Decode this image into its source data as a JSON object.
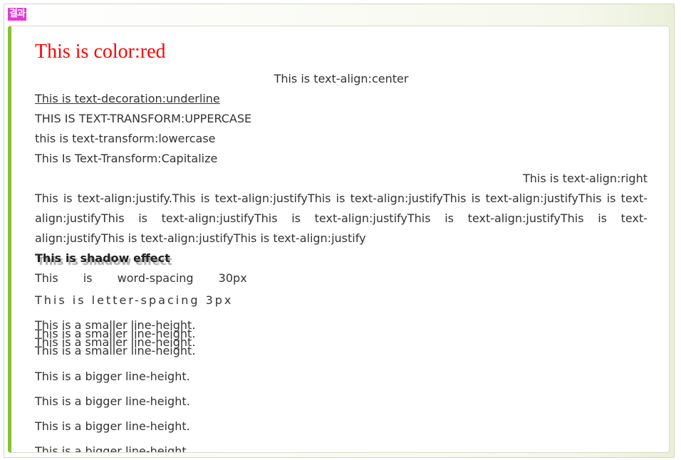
{
  "badge_label": "결과",
  "lines": {
    "red": "This is color:red",
    "center": "This is text-align:center",
    "underline": "This is text-decoration:underline",
    "uppercase": "This is text-transform:uppercase",
    "lowercase": "This is text-transform:lowercase",
    "capitalize": "This is text-transform:capitalize",
    "right": "This is text-align:right",
    "justify": "This is text-align:justify.This is text-align:justifyThis is text-align:justifyThis is text-align:justifyThis is text-align:justifyThis is text-align:justifyThis is text-align:justifyThis is text-align:justifyThis is text-align:justifyThis is text-align:justifyThis is text-align:justify",
    "shadow": "This is shadow effect",
    "word_spacing": "This is word-spacing 30px",
    "letter_spacing": "This is letter-spacing 3px",
    "smaller_line_height": [
      "This is a smaller line-height.",
      "This is a smaller line-height.",
      "This is a smaller line-height.",
      "This is a smaller line-height."
    ],
    "bigger_line_height": [
      "This is a bigger line-height.",
      "This is a bigger line-height.",
      "This is a bigger line-height.",
      "This is a bigger line-height."
    ]
  },
  "colors": {
    "badge": "#e53ad8",
    "accent_bar": "#86c231",
    "red_text": "#ff0000"
  }
}
